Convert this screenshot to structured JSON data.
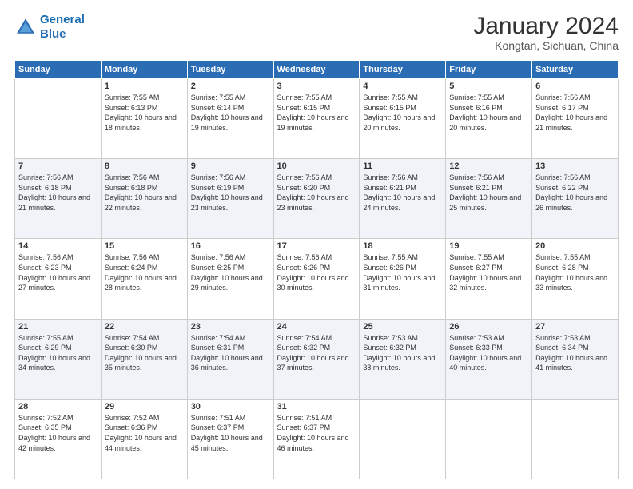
{
  "logo": {
    "line1": "General",
    "line2": "Blue"
  },
  "header": {
    "title": "January 2024",
    "subtitle": "Kongtan, Sichuan, China"
  },
  "columns": [
    "Sunday",
    "Monday",
    "Tuesday",
    "Wednesday",
    "Thursday",
    "Friday",
    "Saturday"
  ],
  "weeks": [
    [
      {
        "day": "",
        "sunrise": "",
        "sunset": "",
        "daylight": ""
      },
      {
        "day": "1",
        "sunrise": "Sunrise: 7:55 AM",
        "sunset": "Sunset: 6:13 PM",
        "daylight": "Daylight: 10 hours and 18 minutes."
      },
      {
        "day": "2",
        "sunrise": "Sunrise: 7:55 AM",
        "sunset": "Sunset: 6:14 PM",
        "daylight": "Daylight: 10 hours and 19 minutes."
      },
      {
        "day": "3",
        "sunrise": "Sunrise: 7:55 AM",
        "sunset": "Sunset: 6:15 PM",
        "daylight": "Daylight: 10 hours and 19 minutes."
      },
      {
        "day": "4",
        "sunrise": "Sunrise: 7:55 AM",
        "sunset": "Sunset: 6:15 PM",
        "daylight": "Daylight: 10 hours and 20 minutes."
      },
      {
        "day": "5",
        "sunrise": "Sunrise: 7:55 AM",
        "sunset": "Sunset: 6:16 PM",
        "daylight": "Daylight: 10 hours and 20 minutes."
      },
      {
        "day": "6",
        "sunrise": "Sunrise: 7:56 AM",
        "sunset": "Sunset: 6:17 PM",
        "daylight": "Daylight: 10 hours and 21 minutes."
      }
    ],
    [
      {
        "day": "7",
        "sunrise": "Sunrise: 7:56 AM",
        "sunset": "Sunset: 6:18 PM",
        "daylight": "Daylight: 10 hours and 21 minutes."
      },
      {
        "day": "8",
        "sunrise": "Sunrise: 7:56 AM",
        "sunset": "Sunset: 6:18 PM",
        "daylight": "Daylight: 10 hours and 22 minutes."
      },
      {
        "day": "9",
        "sunrise": "Sunrise: 7:56 AM",
        "sunset": "Sunset: 6:19 PM",
        "daylight": "Daylight: 10 hours and 23 minutes."
      },
      {
        "day": "10",
        "sunrise": "Sunrise: 7:56 AM",
        "sunset": "Sunset: 6:20 PM",
        "daylight": "Daylight: 10 hours and 23 minutes."
      },
      {
        "day": "11",
        "sunrise": "Sunrise: 7:56 AM",
        "sunset": "Sunset: 6:21 PM",
        "daylight": "Daylight: 10 hours and 24 minutes."
      },
      {
        "day": "12",
        "sunrise": "Sunrise: 7:56 AM",
        "sunset": "Sunset: 6:21 PM",
        "daylight": "Daylight: 10 hours and 25 minutes."
      },
      {
        "day": "13",
        "sunrise": "Sunrise: 7:56 AM",
        "sunset": "Sunset: 6:22 PM",
        "daylight": "Daylight: 10 hours and 26 minutes."
      }
    ],
    [
      {
        "day": "14",
        "sunrise": "Sunrise: 7:56 AM",
        "sunset": "Sunset: 6:23 PM",
        "daylight": "Daylight: 10 hours and 27 minutes."
      },
      {
        "day": "15",
        "sunrise": "Sunrise: 7:56 AM",
        "sunset": "Sunset: 6:24 PM",
        "daylight": "Daylight: 10 hours and 28 minutes."
      },
      {
        "day": "16",
        "sunrise": "Sunrise: 7:56 AM",
        "sunset": "Sunset: 6:25 PM",
        "daylight": "Daylight: 10 hours and 29 minutes."
      },
      {
        "day": "17",
        "sunrise": "Sunrise: 7:56 AM",
        "sunset": "Sunset: 6:26 PM",
        "daylight": "Daylight: 10 hours and 30 minutes."
      },
      {
        "day": "18",
        "sunrise": "Sunrise: 7:55 AM",
        "sunset": "Sunset: 6:26 PM",
        "daylight": "Daylight: 10 hours and 31 minutes."
      },
      {
        "day": "19",
        "sunrise": "Sunrise: 7:55 AM",
        "sunset": "Sunset: 6:27 PM",
        "daylight": "Daylight: 10 hours and 32 minutes."
      },
      {
        "day": "20",
        "sunrise": "Sunrise: 7:55 AM",
        "sunset": "Sunset: 6:28 PM",
        "daylight": "Daylight: 10 hours and 33 minutes."
      }
    ],
    [
      {
        "day": "21",
        "sunrise": "Sunrise: 7:55 AM",
        "sunset": "Sunset: 6:29 PM",
        "daylight": "Daylight: 10 hours and 34 minutes."
      },
      {
        "day": "22",
        "sunrise": "Sunrise: 7:54 AM",
        "sunset": "Sunset: 6:30 PM",
        "daylight": "Daylight: 10 hours and 35 minutes."
      },
      {
        "day": "23",
        "sunrise": "Sunrise: 7:54 AM",
        "sunset": "Sunset: 6:31 PM",
        "daylight": "Daylight: 10 hours and 36 minutes."
      },
      {
        "day": "24",
        "sunrise": "Sunrise: 7:54 AM",
        "sunset": "Sunset: 6:32 PM",
        "daylight": "Daylight: 10 hours and 37 minutes."
      },
      {
        "day": "25",
        "sunrise": "Sunrise: 7:53 AM",
        "sunset": "Sunset: 6:32 PM",
        "daylight": "Daylight: 10 hours and 38 minutes."
      },
      {
        "day": "26",
        "sunrise": "Sunrise: 7:53 AM",
        "sunset": "Sunset: 6:33 PM",
        "daylight": "Daylight: 10 hours and 40 minutes."
      },
      {
        "day": "27",
        "sunrise": "Sunrise: 7:53 AM",
        "sunset": "Sunset: 6:34 PM",
        "daylight": "Daylight: 10 hours and 41 minutes."
      }
    ],
    [
      {
        "day": "28",
        "sunrise": "Sunrise: 7:52 AM",
        "sunset": "Sunset: 6:35 PM",
        "daylight": "Daylight: 10 hours and 42 minutes."
      },
      {
        "day": "29",
        "sunrise": "Sunrise: 7:52 AM",
        "sunset": "Sunset: 6:36 PM",
        "daylight": "Daylight: 10 hours and 44 minutes."
      },
      {
        "day": "30",
        "sunrise": "Sunrise: 7:51 AM",
        "sunset": "Sunset: 6:37 PM",
        "daylight": "Daylight: 10 hours and 45 minutes."
      },
      {
        "day": "31",
        "sunrise": "Sunrise: 7:51 AM",
        "sunset": "Sunset: 6:37 PM",
        "daylight": "Daylight: 10 hours and 46 minutes."
      },
      {
        "day": "",
        "sunrise": "",
        "sunset": "",
        "daylight": ""
      },
      {
        "day": "",
        "sunrise": "",
        "sunset": "",
        "daylight": ""
      },
      {
        "day": "",
        "sunrise": "",
        "sunset": "",
        "daylight": ""
      }
    ]
  ]
}
